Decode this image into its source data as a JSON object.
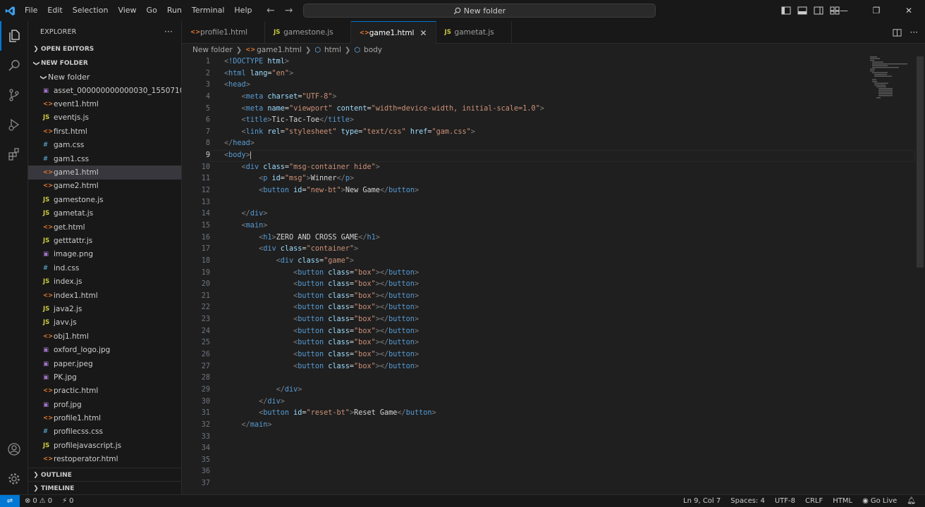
{
  "colors": {
    "accent": "#0078d4",
    "background": "#1f1f1f",
    "sidebar": "#181818",
    "selected": "#37373d"
  },
  "menu": [
    "File",
    "Edit",
    "Selection",
    "View",
    "Go",
    "Run",
    "Terminal",
    "Help"
  ],
  "command_center": {
    "label": "New folder"
  },
  "explorer": {
    "title": "EXPLORER",
    "more": "···",
    "open_editors": "OPEN EDITORS",
    "workspace": "NEW FOLDER",
    "folder": "New folder",
    "files": [
      {
        "name": "asset_000000000000030_1550710...",
        "type": "img"
      },
      {
        "name": "event1.html",
        "type": "html"
      },
      {
        "name": "eventjs.js",
        "type": "js"
      },
      {
        "name": "first.html",
        "type": "html"
      },
      {
        "name": "gam.css",
        "type": "css"
      },
      {
        "name": "gam1.css",
        "type": "css"
      },
      {
        "name": "game1.html",
        "type": "html",
        "selected": true
      },
      {
        "name": "game2.html",
        "type": "html"
      },
      {
        "name": "gamestone.js",
        "type": "js"
      },
      {
        "name": "gametat.js",
        "type": "js"
      },
      {
        "name": "get.html",
        "type": "html"
      },
      {
        "name": "getttattr.js",
        "type": "js"
      },
      {
        "name": "image.png",
        "type": "img"
      },
      {
        "name": "ind.css",
        "type": "css"
      },
      {
        "name": "index.js",
        "type": "js"
      },
      {
        "name": "index1.html",
        "type": "html"
      },
      {
        "name": "java2.js",
        "type": "js"
      },
      {
        "name": "javv.js",
        "type": "js"
      },
      {
        "name": "obj1.html",
        "type": "html"
      },
      {
        "name": "oxford_logo.jpg",
        "type": "img"
      },
      {
        "name": "paper.jpeg",
        "type": "img"
      },
      {
        "name": "PK.jpg",
        "type": "img"
      },
      {
        "name": "practic.html",
        "type": "html"
      },
      {
        "name": "prof.jpg",
        "type": "img"
      },
      {
        "name": "profile1.html",
        "type": "html"
      },
      {
        "name": "profilecss.css",
        "type": "css"
      },
      {
        "name": "profilejavascript.js",
        "type": "js"
      },
      {
        "name": "restoperator.html",
        "type": "html"
      }
    ],
    "outline": "OUTLINE",
    "timeline": "TIMELINE"
  },
  "tabs": [
    {
      "label": "profile1.html",
      "type": "html",
      "active": false
    },
    {
      "label": "gamestone.js",
      "type": "js",
      "active": false
    },
    {
      "label": "game1.html",
      "type": "html",
      "active": true
    },
    {
      "label": "gametat.js",
      "type": "js",
      "active": false
    }
  ],
  "breadcrumb": [
    "New folder",
    "game1.html",
    "html",
    "body"
  ],
  "icon_glyphs": {
    "html": "<>",
    "js": "JS",
    "css": "#",
    "img": "▣"
  },
  "code": {
    "current_line": 9,
    "lines": [
      [
        [
          "br",
          "<"
        ],
        [
          "tag",
          "!DOCTYPE"
        ],
        [
          "text",
          " "
        ],
        [
          "attr",
          "html"
        ],
        [
          "br",
          ">"
        ]
      ],
      [
        [
          "br",
          "<"
        ],
        [
          "tag",
          "html"
        ],
        [
          "text",
          " "
        ],
        [
          "attr",
          "lang"
        ],
        [
          "text",
          "="
        ],
        [
          "str",
          "\"en\""
        ],
        [
          "br",
          ">"
        ]
      ],
      [
        [
          "br",
          "<"
        ],
        [
          "tag",
          "head"
        ],
        [
          "br",
          ">"
        ]
      ],
      [
        [
          "text",
          "    "
        ],
        [
          "br",
          "<"
        ],
        [
          "tag",
          "meta"
        ],
        [
          "text",
          " "
        ],
        [
          "attr",
          "charset"
        ],
        [
          "text",
          "="
        ],
        [
          "str",
          "\"UTF-8\""
        ],
        [
          "br",
          ">"
        ]
      ],
      [
        [
          "text",
          "    "
        ],
        [
          "br",
          "<"
        ],
        [
          "tag",
          "meta"
        ],
        [
          "text",
          " "
        ],
        [
          "attr",
          "name"
        ],
        [
          "text",
          "="
        ],
        [
          "str",
          "\"viewport\""
        ],
        [
          "text",
          " "
        ],
        [
          "attr",
          "content"
        ],
        [
          "text",
          "="
        ],
        [
          "str",
          "\"width=device-width, initial-scale=1.0\""
        ],
        [
          "br",
          ">"
        ]
      ],
      [
        [
          "text",
          "    "
        ],
        [
          "br",
          "<"
        ],
        [
          "tag",
          "title"
        ],
        [
          "br",
          ">"
        ],
        [
          "text",
          "Tic-Tac-Toe"
        ],
        [
          "br",
          "</"
        ],
        [
          "tag",
          "title"
        ],
        [
          "br",
          ">"
        ]
      ],
      [
        [
          "text",
          "    "
        ],
        [
          "br",
          "<"
        ],
        [
          "tag",
          "link"
        ],
        [
          "text",
          " "
        ],
        [
          "attr",
          "rel"
        ],
        [
          "text",
          "="
        ],
        [
          "str",
          "\"stylesheet\""
        ],
        [
          "text",
          " "
        ],
        [
          "attr",
          "type"
        ],
        [
          "text",
          "="
        ],
        [
          "str",
          "\"text/css\""
        ],
        [
          "text",
          " "
        ],
        [
          "attr",
          "href"
        ],
        [
          "text",
          "="
        ],
        [
          "str",
          "\"gam.css\""
        ],
        [
          "br",
          ">"
        ]
      ],
      [
        [
          "br",
          "</"
        ],
        [
          "tag",
          "head"
        ],
        [
          "br",
          ">"
        ]
      ],
      [
        [
          "br",
          "<"
        ],
        [
          "tag",
          "body"
        ],
        [
          "br",
          ">"
        ]
      ],
      [
        [
          "text",
          "    "
        ],
        [
          "br",
          "<"
        ],
        [
          "tag",
          "div"
        ],
        [
          "text",
          " "
        ],
        [
          "attr",
          "class"
        ],
        [
          "text",
          "="
        ],
        [
          "str",
          "\"msg-container hide\""
        ],
        [
          "br",
          ">"
        ]
      ],
      [
        [
          "text",
          "        "
        ],
        [
          "br",
          "<"
        ],
        [
          "tag",
          "p"
        ],
        [
          "text",
          " "
        ],
        [
          "attr",
          "id"
        ],
        [
          "text",
          "="
        ],
        [
          "str",
          "\"msg\""
        ],
        [
          "br",
          ">"
        ],
        [
          "text",
          "Winner"
        ],
        [
          "br",
          "</"
        ],
        [
          "tag",
          "p"
        ],
        [
          "br",
          ">"
        ]
      ],
      [
        [
          "text",
          "        "
        ],
        [
          "br",
          "<"
        ],
        [
          "tag",
          "button"
        ],
        [
          "text",
          " "
        ],
        [
          "attr",
          "id"
        ],
        [
          "text",
          "="
        ],
        [
          "str",
          "\"new-bt\""
        ],
        [
          "br",
          ">"
        ],
        [
          "text",
          "New Game"
        ],
        [
          "br",
          "</"
        ],
        [
          "tag",
          "button"
        ],
        [
          "br",
          ">"
        ]
      ],
      [],
      [
        [
          "text",
          "    "
        ],
        [
          "br",
          "</"
        ],
        [
          "tag",
          "div"
        ],
        [
          "br",
          ">"
        ]
      ],
      [
        [
          "text",
          "    "
        ],
        [
          "br",
          "<"
        ],
        [
          "tag",
          "main"
        ],
        [
          "br",
          ">"
        ]
      ],
      [
        [
          "text",
          "        "
        ],
        [
          "br",
          "<"
        ],
        [
          "tag",
          "h1"
        ],
        [
          "br",
          ">"
        ],
        [
          "text",
          "ZERO AND CROSS GAME"
        ],
        [
          "br",
          "</"
        ],
        [
          "tag",
          "h1"
        ],
        [
          "br",
          ">"
        ]
      ],
      [
        [
          "text",
          "        "
        ],
        [
          "br",
          "<"
        ],
        [
          "tag",
          "div"
        ],
        [
          "text",
          " "
        ],
        [
          "attr",
          "class"
        ],
        [
          "text",
          "="
        ],
        [
          "str",
          "\"container\""
        ],
        [
          "br",
          ">"
        ]
      ],
      [
        [
          "text",
          "            "
        ],
        [
          "br",
          "<"
        ],
        [
          "tag",
          "div"
        ],
        [
          "text",
          " "
        ],
        [
          "attr",
          "class"
        ],
        [
          "text",
          "="
        ],
        [
          "str",
          "\"game\""
        ],
        [
          "br",
          ">"
        ]
      ],
      [
        [
          "text",
          "                "
        ],
        [
          "br",
          "<"
        ],
        [
          "tag",
          "button"
        ],
        [
          "text",
          " "
        ],
        [
          "attr",
          "class"
        ],
        [
          "text",
          "="
        ],
        [
          "str",
          "\"box\""
        ],
        [
          "br",
          "></"
        ],
        [
          "tag",
          "button"
        ],
        [
          "br",
          ">"
        ]
      ],
      [
        [
          "text",
          "                "
        ],
        [
          "br",
          "<"
        ],
        [
          "tag",
          "button"
        ],
        [
          "text",
          " "
        ],
        [
          "attr",
          "class"
        ],
        [
          "text",
          "="
        ],
        [
          "str",
          "\"box\""
        ],
        [
          "br",
          "></"
        ],
        [
          "tag",
          "button"
        ],
        [
          "br",
          ">"
        ]
      ],
      [
        [
          "text",
          "                "
        ],
        [
          "br",
          "<"
        ],
        [
          "tag",
          "button"
        ],
        [
          "text",
          " "
        ],
        [
          "attr",
          "class"
        ],
        [
          "text",
          "="
        ],
        [
          "str",
          "\"box\""
        ],
        [
          "br",
          "></"
        ],
        [
          "tag",
          "button"
        ],
        [
          "br",
          ">"
        ]
      ],
      [
        [
          "text",
          "                "
        ],
        [
          "br",
          "<"
        ],
        [
          "tag",
          "button"
        ],
        [
          "text",
          " "
        ],
        [
          "attr",
          "class"
        ],
        [
          "text",
          "="
        ],
        [
          "str",
          "\"box\""
        ],
        [
          "br",
          "></"
        ],
        [
          "tag",
          "button"
        ],
        [
          "br",
          ">"
        ]
      ],
      [
        [
          "text",
          "                "
        ],
        [
          "br",
          "<"
        ],
        [
          "tag",
          "button"
        ],
        [
          "text",
          " "
        ],
        [
          "attr",
          "class"
        ],
        [
          "text",
          "="
        ],
        [
          "str",
          "\"box\""
        ],
        [
          "br",
          "></"
        ],
        [
          "tag",
          "button"
        ],
        [
          "br",
          ">"
        ]
      ],
      [
        [
          "text",
          "                "
        ],
        [
          "br",
          "<"
        ],
        [
          "tag",
          "button"
        ],
        [
          "text",
          " "
        ],
        [
          "attr",
          "class"
        ],
        [
          "text",
          "="
        ],
        [
          "str",
          "\"box\""
        ],
        [
          "br",
          "></"
        ],
        [
          "tag",
          "button"
        ],
        [
          "br",
          ">"
        ]
      ],
      [
        [
          "text",
          "                "
        ],
        [
          "br",
          "<"
        ],
        [
          "tag",
          "button"
        ],
        [
          "text",
          " "
        ],
        [
          "attr",
          "class"
        ],
        [
          "text",
          "="
        ],
        [
          "str",
          "\"box\""
        ],
        [
          "br",
          "></"
        ],
        [
          "tag",
          "button"
        ],
        [
          "br",
          ">"
        ]
      ],
      [
        [
          "text",
          "                "
        ],
        [
          "br",
          "<"
        ],
        [
          "tag",
          "button"
        ],
        [
          "text",
          " "
        ],
        [
          "attr",
          "class"
        ],
        [
          "text",
          "="
        ],
        [
          "str",
          "\"box\""
        ],
        [
          "br",
          "></"
        ],
        [
          "tag",
          "button"
        ],
        [
          "br",
          ">"
        ]
      ],
      [
        [
          "text",
          "                "
        ],
        [
          "br",
          "<"
        ],
        [
          "tag",
          "button"
        ],
        [
          "text",
          " "
        ],
        [
          "attr",
          "class"
        ],
        [
          "text",
          "="
        ],
        [
          "str",
          "\"box\""
        ],
        [
          "br",
          "></"
        ],
        [
          "tag",
          "button"
        ],
        [
          "br",
          ">"
        ]
      ],
      [],
      [
        [
          "text",
          "            "
        ],
        [
          "br",
          "</"
        ],
        [
          "tag",
          "div"
        ],
        [
          "br",
          ">"
        ]
      ],
      [
        [
          "text",
          "        "
        ],
        [
          "br",
          "</"
        ],
        [
          "tag",
          "div"
        ],
        [
          "br",
          ">"
        ]
      ],
      [
        [
          "text",
          "        "
        ],
        [
          "br",
          "<"
        ],
        [
          "tag",
          "button"
        ],
        [
          "text",
          " "
        ],
        [
          "attr",
          "id"
        ],
        [
          "text",
          "="
        ],
        [
          "str",
          "\"reset-bt\""
        ],
        [
          "br",
          ">"
        ],
        [
          "text",
          "Reset Game"
        ],
        [
          "br",
          "</"
        ],
        [
          "tag",
          "button"
        ],
        [
          "br",
          ">"
        ]
      ],
      [
        [
          "text",
          "    "
        ],
        [
          "br",
          "</"
        ],
        [
          "tag",
          "main"
        ],
        [
          "br",
          ">"
        ]
      ],
      [],
      [],
      [],
      [],
      []
    ]
  },
  "status": {
    "errors": "0",
    "warnings": "0",
    "ports": "0",
    "position": "Ln 9, Col 7",
    "spaces": "Spaces: 4",
    "encoding": "UTF-8",
    "eol": "CRLF",
    "language": "HTML",
    "golive": "Go Live"
  }
}
